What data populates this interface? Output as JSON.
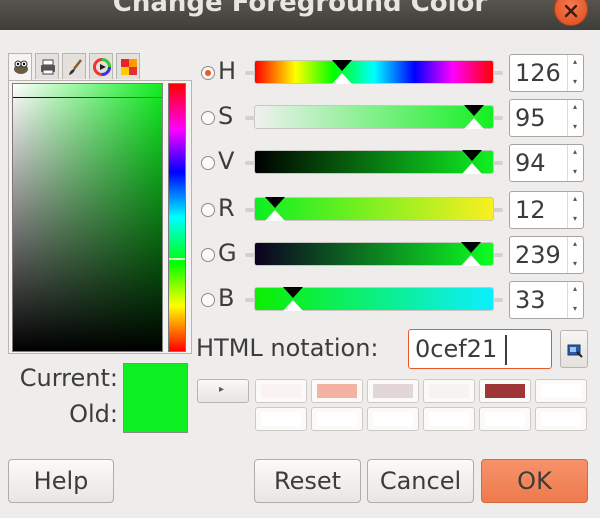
{
  "window": {
    "title": "Change Foreground Color",
    "colors": {
      "titlebar": "#403e3a",
      "accent": "#e8592a",
      "close": "#e9592a"
    }
  },
  "selector_tabs": [
    {
      "icon": "gimp-wilber-icon"
    },
    {
      "icon": "cmyk-printer-icon"
    },
    {
      "icon": "watercolor-brush-icon"
    },
    {
      "icon": "color-wheel-icon"
    },
    {
      "icon": "palette-grid-icon"
    }
  ],
  "color_area": {
    "hue_marker_fraction": 0.65,
    "saturation": 95,
    "value": 94
  },
  "current": {
    "label": "Current:",
    "color": "#0cef21"
  },
  "old": {
    "label": "Old:",
    "color": "#0cef21"
  },
  "channels": [
    {
      "name": "H",
      "value": "126",
      "level": 0.35,
      "selected": true
    },
    {
      "name": "S",
      "value": "95",
      "level": 0.95,
      "selected": false
    },
    {
      "name": "V",
      "value": "94",
      "level": 0.94,
      "selected": false
    },
    {
      "name": "R",
      "value": "12",
      "level": 0.047,
      "selected": false
    },
    {
      "name": "G",
      "value": "239",
      "level": 0.937,
      "selected": false
    },
    {
      "name": "B",
      "value": "33",
      "level": 0.129,
      "selected": false
    }
  ],
  "html_notation": {
    "label": "HTML notation:",
    "value": "0cef21"
  },
  "history": {
    "arrow": "▸",
    "row1": [
      "#fbf3f1",
      "#f5b1a4",
      "#e3d6d6",
      "#f6f4f3",
      "#9e3536",
      "#ffffff"
    ],
    "row2": [
      "#ffffff",
      "#ffffff",
      "#ffffff",
      "#ffffff",
      "#ffffff",
      "#ffffff"
    ]
  },
  "buttons": {
    "help": "Help",
    "reset": "Reset",
    "cancel": "Cancel",
    "ok": "OK"
  }
}
